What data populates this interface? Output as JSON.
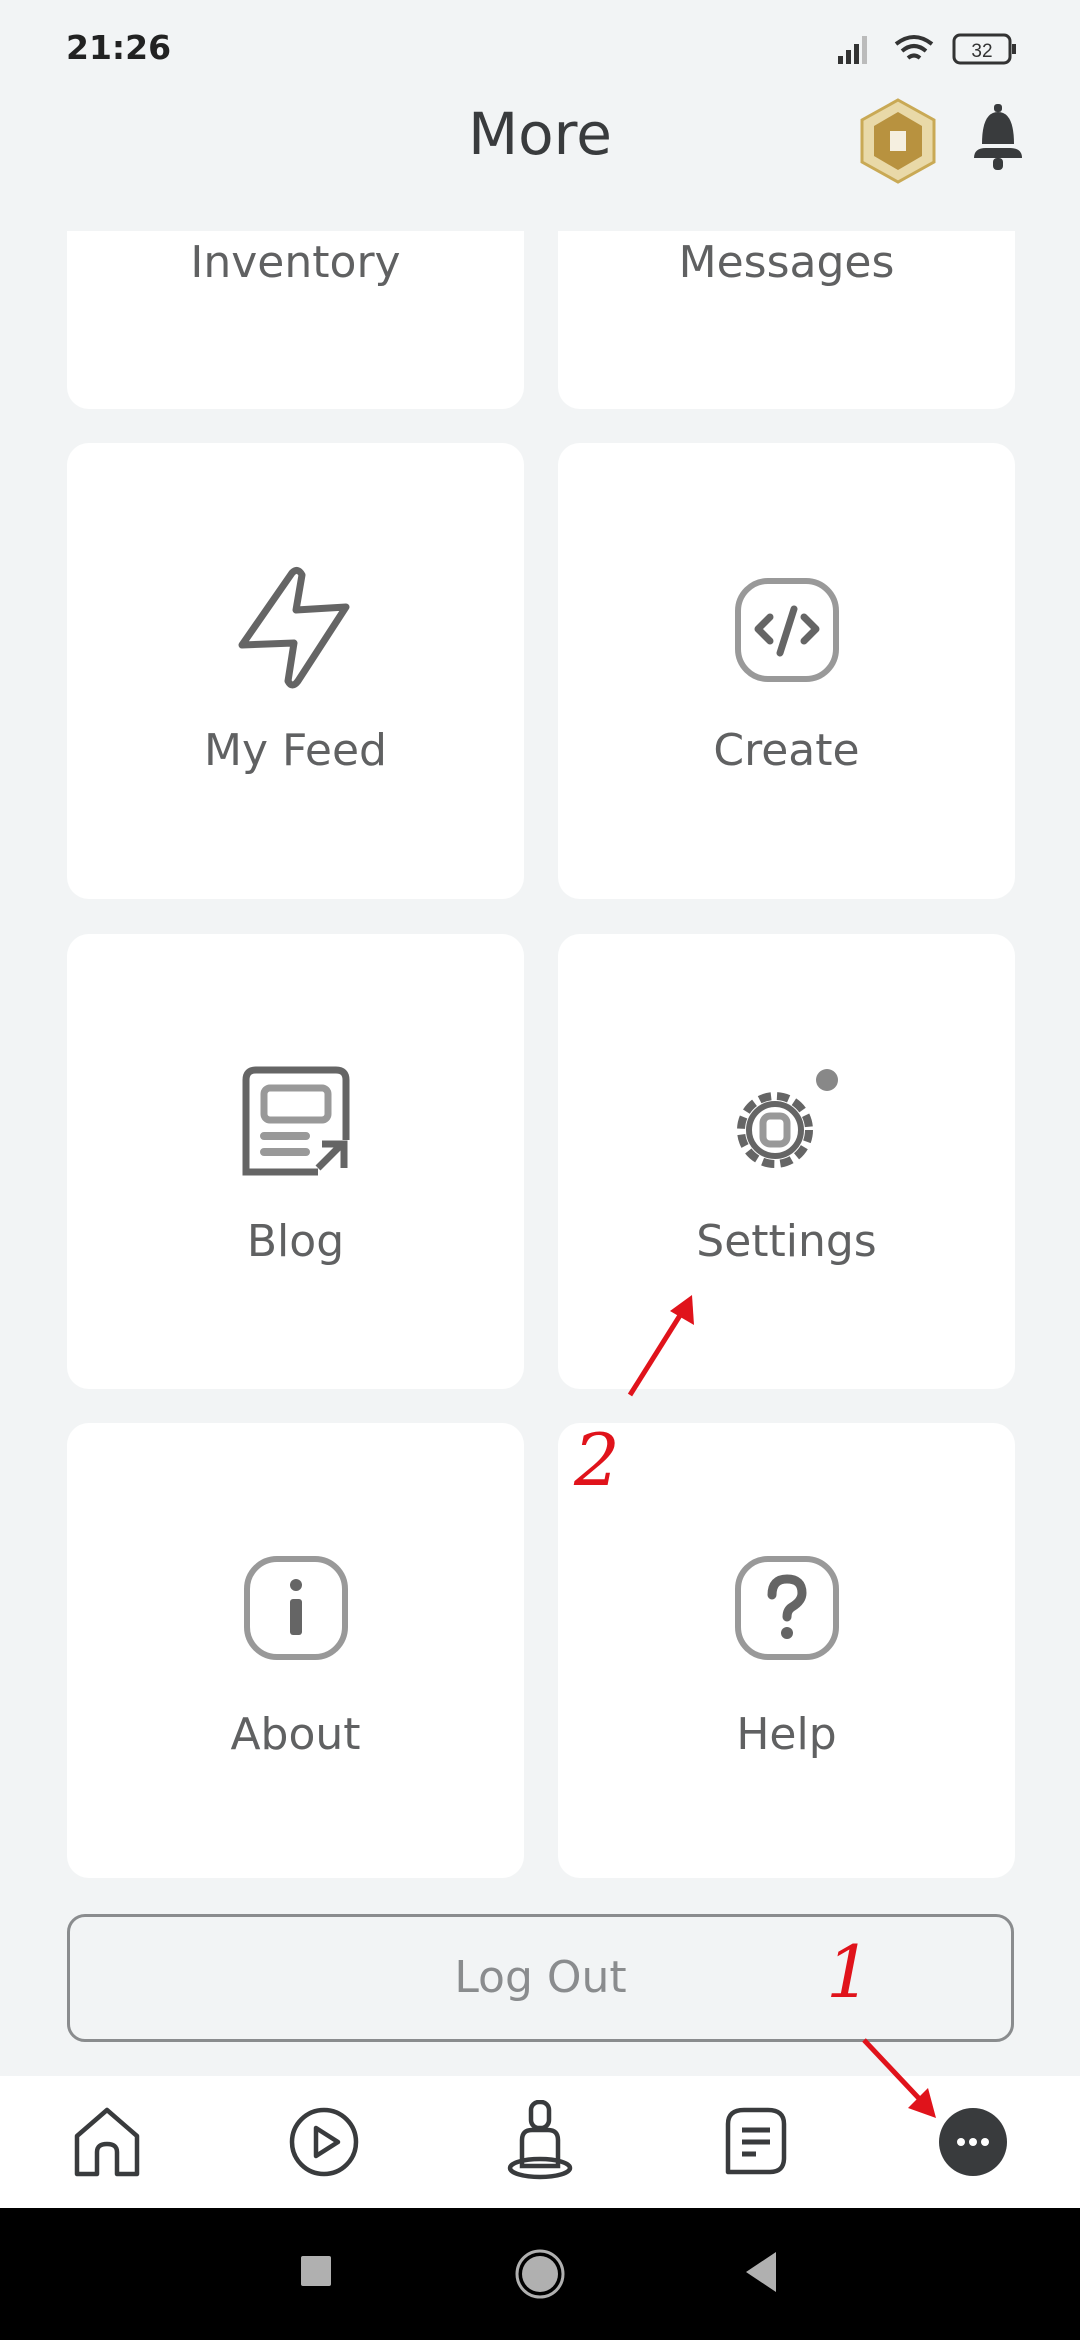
{
  "status_bar": {
    "time": "21:26",
    "battery": "32"
  },
  "header": {
    "title": "More",
    "robux_icon": "robux-coin-icon",
    "notification_icon": "bell-icon"
  },
  "menu": {
    "inventory": "Inventory",
    "messages": "Messages",
    "my_feed": "My Feed",
    "create": "Create",
    "blog": "Blog",
    "settings": "Settings",
    "about": "About",
    "help": "Help"
  },
  "logout_label": "Log Out",
  "bottom_nav": [
    "home-icon",
    "discover-play-icon",
    "avatar-icon",
    "chat-icon",
    "more-icon"
  ],
  "annotations": {
    "step1": "1",
    "step2": "2"
  },
  "colors": {
    "annotation": "#e0131b",
    "active_nav": "#393b3d"
  }
}
